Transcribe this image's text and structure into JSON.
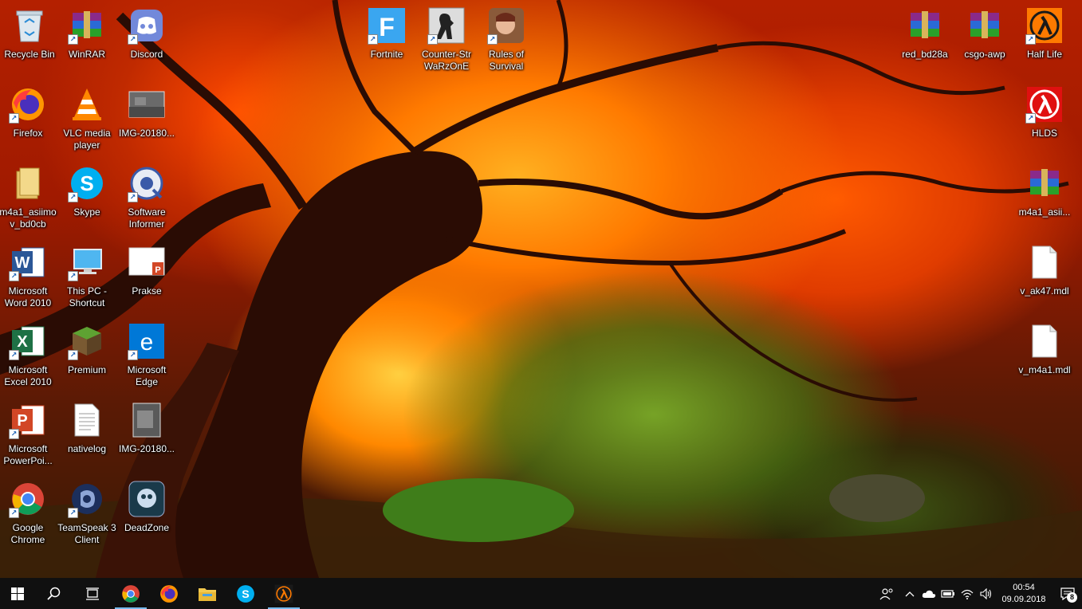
{
  "desktop_icons": {
    "recycle_bin": "Recycle Bin",
    "winrar": "WinRAR",
    "discord": "Discord",
    "fortnite": "Fortnite",
    "counter_strike": "Counter-Str WaRzOnE",
    "rules_of_survival": "Rules of Survival",
    "red_bd28a": "red_bd28a",
    "csgo_awp": "csgo-awp",
    "half_life": "Half Life",
    "firefox": "Firefox",
    "vlc": "VLC media player",
    "img1": "IMG-20180...",
    "hlds": "HLDS",
    "m4a1_folder": "m4a1_asiimo v_bd0cb",
    "skype": "Skype",
    "software_informer": "Software Informer",
    "m4a1_rar": "m4a1_asii...",
    "word": "Microsoft Word 2010",
    "this_pc": "This PC - Shortcut",
    "prakse": "Prakse",
    "v_ak47": "v_ak47.mdl",
    "excel": "Microsoft Excel 2010",
    "premium": "Premium",
    "edge": "Microsoft Edge",
    "v_m4a1": "v_m4a1.mdl",
    "powerpoint": "Microsoft PowerPoi...",
    "nativelog": "nativelog",
    "img2": "IMG-20180...",
    "chrome": "Google Chrome",
    "teamspeak": "TeamSpeak 3 Client",
    "deadzone": "DeadZone"
  },
  "taskbar": {
    "time": "00:54",
    "date": "09.09.2018",
    "notification_count": "8"
  }
}
